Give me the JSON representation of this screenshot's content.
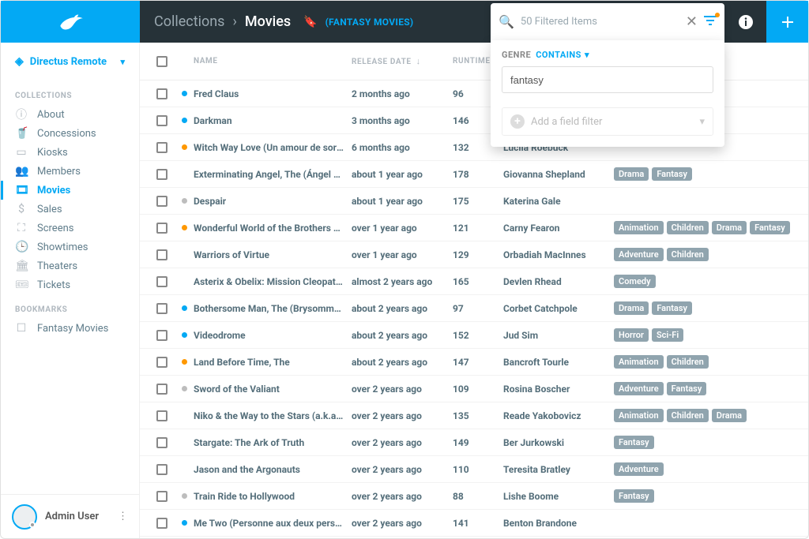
{
  "project_name": "Directus Remote",
  "breadcrumb": {
    "parent": "Collections",
    "current": "Movies",
    "bookmark": "(FANTASY MOVIES)"
  },
  "search": {
    "placeholder": "50 Filtered Items"
  },
  "filter": {
    "field_label": "GENRE",
    "op_label": "CONTAINS",
    "value": "fantasy",
    "add_placeholder": "Add a field filter"
  },
  "nav": {
    "collections_header": "COLLECTIONS",
    "bookmarks_header": "BOOKMARKS",
    "items": [
      {
        "label": "About"
      },
      {
        "label": "Concessions"
      },
      {
        "label": "Kiosks"
      },
      {
        "label": "Members"
      },
      {
        "label": "Movies"
      },
      {
        "label": "Sales"
      },
      {
        "label": "Screens"
      },
      {
        "label": "Showtimes"
      },
      {
        "label": "Theaters"
      },
      {
        "label": "Tickets"
      }
    ],
    "bookmarks": [
      {
        "label": "Fantasy Movies"
      }
    ]
  },
  "user": {
    "name": "Admin User"
  },
  "columns": {
    "name": "NAME",
    "release": "RELEASE DATE",
    "runtime": "RUNTIME"
  },
  "rows": [
    {
      "dot": "blue",
      "name": "Fred Claus",
      "release": "2 months ago",
      "runtime": "96",
      "director": "",
      "tags": []
    },
    {
      "dot": "blue",
      "name": "Darkman",
      "release": "3 months ago",
      "runtime": "146",
      "director": "",
      "tags": []
    },
    {
      "dot": "orange",
      "name": "Witch Way Love (Un amour de sorc...",
      "release": "6 months ago",
      "runtime": "132",
      "director": "Lucila Roebuck",
      "tags": []
    },
    {
      "dot": "",
      "name": "Exterminating Angel, The (Ángel ex...",
      "release": "about 1 year ago",
      "runtime": "178",
      "director": "Giovanna Shepland",
      "tags": [
        "Drama",
        "Fantasy"
      ]
    },
    {
      "dot": "grey",
      "name": "Despair",
      "release": "about 1 year ago",
      "runtime": "175",
      "director": "Katerina Gale",
      "tags": []
    },
    {
      "dot": "orange",
      "name": "Wonderful World of the Brothers Gr...",
      "release": "over 1 year ago",
      "runtime": "121",
      "director": "Carny Fearon",
      "tags": [
        "Animation",
        "Children",
        "Drama",
        "Fantasy"
      ]
    },
    {
      "dot": "",
      "name": "Warriors of Virtue",
      "release": "over 1 year ago",
      "runtime": "129",
      "director": "Orbadiah MacInnes",
      "tags": [
        "Adventure",
        "Children"
      ]
    },
    {
      "dot": "",
      "name": "Asterix & Obelix: Mission Cleopatra...",
      "release": "almost 2 years ago",
      "runtime": "165",
      "director": "Devlen Rhead",
      "tags": [
        "Comedy"
      ]
    },
    {
      "dot": "blue",
      "name": "Bothersome Man, The (Brysomme ...",
      "release": "about 2 years ago",
      "runtime": "97",
      "director": "Corbet Catchpole",
      "tags": [
        "Drama",
        "Fantasy"
      ]
    },
    {
      "dot": "blue",
      "name": "Videodrome",
      "release": "about 2 years ago",
      "runtime": "152",
      "director": "Jud Sim",
      "tags": [
        "Horror",
        "Sci-Fi"
      ]
    },
    {
      "dot": "orange",
      "name": "Land Before Time, The",
      "release": "about 2 years ago",
      "runtime": "147",
      "director": "Bancroft Tourle",
      "tags": [
        "Animation",
        "Children"
      ]
    },
    {
      "dot": "grey",
      "name": "Sword of the Valiant",
      "release": "over 2 years ago",
      "runtime": "109",
      "director": "Rosina Boscher",
      "tags": [
        "Adventure",
        "Fantasy"
      ]
    },
    {
      "dot": "",
      "name": "Niko & the Way to the Stars (a.k.a. ...",
      "release": "over 2 years ago",
      "runtime": "135",
      "director": "Reade Yakobovicz",
      "tags": [
        "Animation",
        "Children",
        "Drama"
      ]
    },
    {
      "dot": "",
      "name": "Stargate: The Ark of Truth",
      "release": "over 2 years ago",
      "runtime": "149",
      "director": "Ber Jurkowski",
      "tags": [
        "Fantasy"
      ]
    },
    {
      "dot": "",
      "name": "Jason and the Argonauts",
      "release": "over 2 years ago",
      "runtime": "110",
      "director": "Teresita Bratley",
      "tags": [
        "Adventure"
      ]
    },
    {
      "dot": "grey",
      "name": "Train Ride to Hollywood",
      "release": "over 2 years ago",
      "runtime": "88",
      "director": "Lishe Boome",
      "tags": [
        "Fantasy"
      ]
    },
    {
      "dot": "blue",
      "name": "Me Two (Personne aux deux perso...",
      "release": "over 2 years ago",
      "runtime": "141",
      "director": "Benton Brandone",
      "tags": []
    }
  ]
}
